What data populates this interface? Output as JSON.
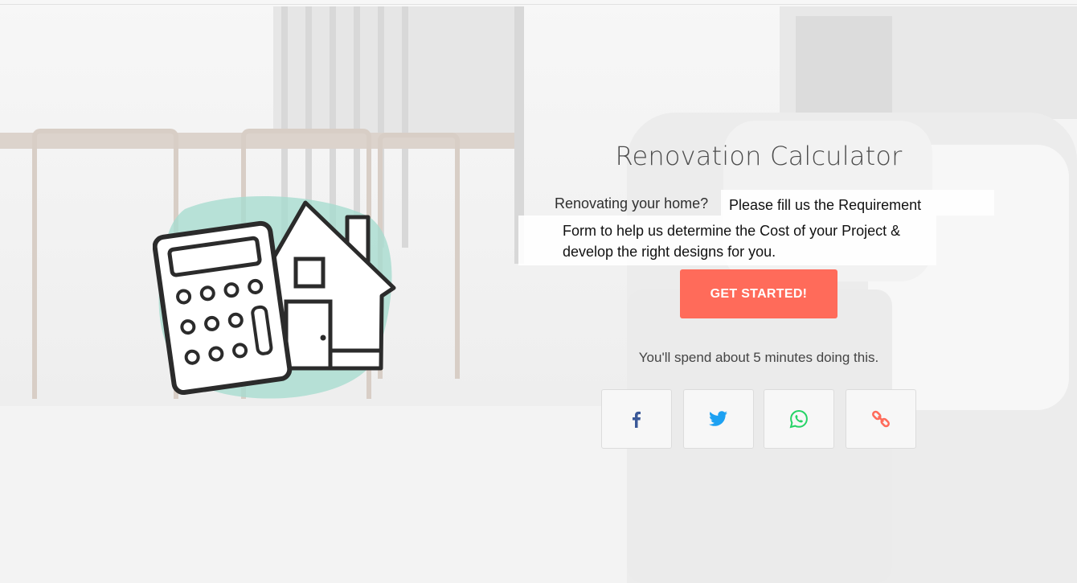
{
  "calculator": {
    "title": "Renovation Calculator",
    "lead": "Renovating your home?",
    "requirement_line1": "Please fill us the Requirement",
    "requirement_line2": "Form to help us determine the Cost of your Project &",
    "requirement_line3": "develop the right designs for you.",
    "cta_label": "GET STARTED!",
    "time_note": "You'll spend about 5 minutes doing this."
  },
  "share": [
    {
      "name": "facebook",
      "icon": "facebook-icon",
      "color": "#3b5998"
    },
    {
      "name": "twitter",
      "icon": "twitter-icon",
      "color": "#1da1f2"
    },
    {
      "name": "whatsapp",
      "icon": "whatsapp-icon",
      "color": "#25d366"
    },
    {
      "name": "copy-link",
      "icon": "link-icon",
      "color": "#ff6b5a"
    }
  ],
  "colors": {
    "accent": "#ff6b5a",
    "illustration_blob": "#a8dccf"
  }
}
